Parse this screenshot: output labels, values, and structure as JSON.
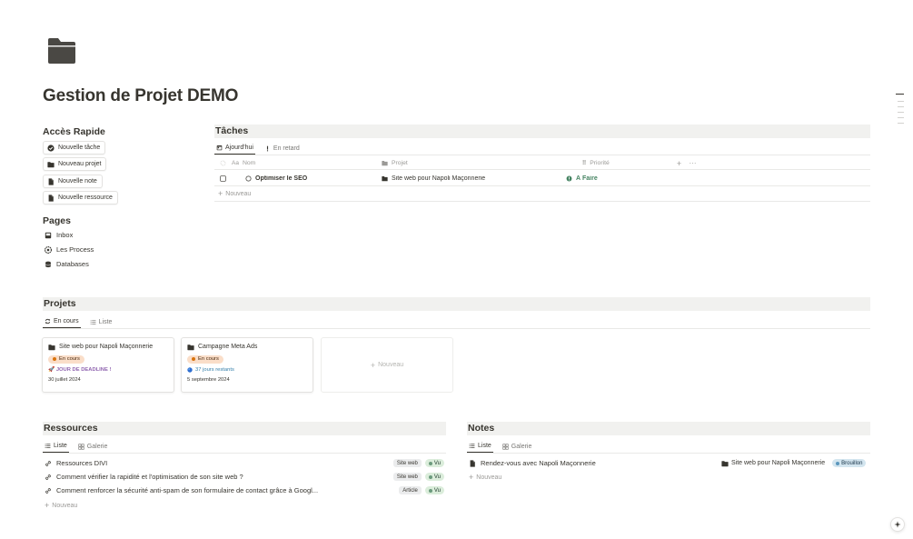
{
  "page": {
    "title": "Gestion de Projet DEMO"
  },
  "quick_access": {
    "title": "Accès Rapide",
    "buttons": [
      {
        "label": "Nouvelle tâche",
        "icon": "check-circle-icon"
      },
      {
        "label": "Nouveau projet",
        "icon": "folder-icon"
      },
      {
        "label": "Nouvelle note",
        "icon": "document-icon"
      },
      {
        "label": "Nouvelle ressource",
        "icon": "document-icon"
      }
    ]
  },
  "pages": {
    "title": "Pages",
    "links": [
      {
        "label": "Inbox",
        "icon": "inbox-icon"
      },
      {
        "label": "Les Process",
        "icon": "gear-icon"
      },
      {
        "label": "Databases",
        "icon": "database-icon"
      }
    ]
  },
  "tasks": {
    "title": "Tâches",
    "tabs": [
      "Ajourd'hui",
      "En retard"
    ],
    "columns": {
      "name": "Nom",
      "project": "Projet",
      "priority": "Priorité"
    },
    "rows": [
      {
        "name": "Optimiser le SEO",
        "project": "Site web pour Napoli Maçonnerie",
        "priority": "À Faire"
      }
    ],
    "new_label": "Nouveau"
  },
  "projects": {
    "title": "Projets",
    "tabs": [
      "En cours",
      "Liste"
    ],
    "cards": [
      {
        "title": "Site web pour Napoli Maçonnerie",
        "status": "En cours",
        "deadline": "🚀 JOUR DE DEADLINE !",
        "date": "30 juillet 2024"
      },
      {
        "title": "Campagne Meta Ads",
        "status": "En cours",
        "deadline": "37 jours restants",
        "date": "5 septembre 2024"
      }
    ],
    "new_label": "Nouveau"
  },
  "resources": {
    "title": "Ressources",
    "tabs": [
      "Liste",
      "Galerie"
    ],
    "rows": [
      {
        "name": "Ressources DIVI",
        "tag": "Site web",
        "status": "Vu"
      },
      {
        "name": "Comment vérifier la rapidité et l'optimisation de son site web ?",
        "tag": "Site web",
        "status": "Vu"
      },
      {
        "name": "Comment renforcer la sécurité anti-spam de son formulaire de contact grâce à Googl...",
        "tag": "Article",
        "status": "Vu"
      }
    ],
    "new_label": "Nouveau"
  },
  "notes": {
    "title": "Notes",
    "tabs": [
      "Liste",
      "Galerie"
    ],
    "rows": [
      {
        "name": "Rendez-vous avec Napoli Maçonnerie",
        "project": "Site web pour Napoli Maçonnerie",
        "status": "Brouillon"
      }
    ],
    "new_label": "Nouveau"
  },
  "colors": {
    "text": "#37352f",
    "muted": "#9b9a97",
    "status_green": "#448361",
    "deadline_purple": "#9065b0",
    "days_blue": "#337ea9",
    "orange_bg": "#fadec9"
  }
}
